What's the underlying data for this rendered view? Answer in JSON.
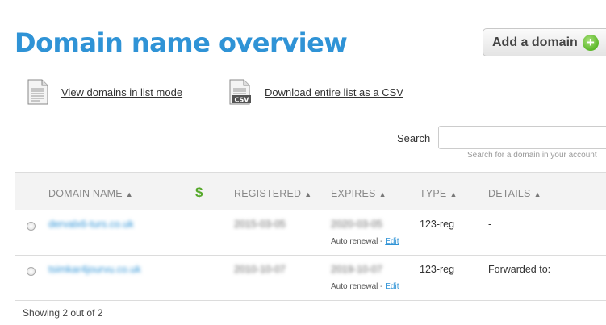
{
  "page": {
    "title": "Domain name overview"
  },
  "add_domain": {
    "label": "Add a domain",
    "icon": "plus-circle-icon"
  },
  "actions": {
    "list_mode": {
      "label": "View domains in list mode",
      "icon": "document-icon"
    },
    "csv": {
      "label": "Download entire list as a CSV",
      "icon": "csv-file-icon"
    }
  },
  "search": {
    "label": "Search",
    "value": "",
    "hint": "Search for a domain in your account"
  },
  "table": {
    "headers": {
      "domain": "DOMAIN NAME",
      "registered": "REGISTERED",
      "expires": "EXPIRES",
      "type": "TYPE",
      "details": "DETAILS"
    },
    "sort_glyph": "▲",
    "price_glyph": "$",
    "rows": [
      {
        "domain": "dervalx6-turs.co.uk",
        "registered": "2015-03-05",
        "expires": "2020-03-05",
        "renewal": "Auto renewal -",
        "edit": "Edit",
        "type": "123-reg",
        "details": "-"
      },
      {
        "domain": "tsimkar4jourvu.co.uk",
        "registered": "2010-10-07",
        "expires": "2019-10-07",
        "renewal": "Auto renewal -",
        "edit": "Edit",
        "type": "123-reg",
        "details": "Forwarded to:"
      }
    ]
  },
  "footer": {
    "text": "Showing 2 out of 2"
  },
  "colors": {
    "title": "#2f93d6",
    "accent_green": "#5cb82a",
    "header_bg": "#f3f3f3"
  }
}
